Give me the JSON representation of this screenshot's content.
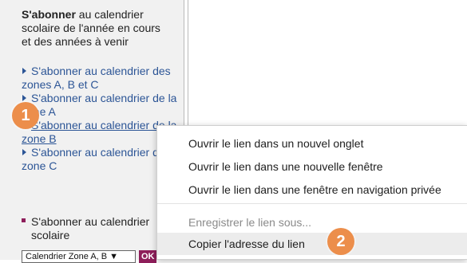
{
  "sidebar": {
    "intro_bold": "S'abonner",
    "intro_rest": " au calendrier scolaire de l'année en cours et des années à venir",
    "links": [
      {
        "label": "S'abonner au calendrier des zones A, B et C"
      },
      {
        "label": "S'abonner au calendrier de la zone A"
      },
      {
        "label": "S'abonner au calendrier de la zone B"
      },
      {
        "label": "S'abonner au calendrier de la zone C"
      }
    ],
    "subscribe_label": "S'abonner au calendrier scolaire",
    "select_value": "Calendrier Zone A, B ▼",
    "ok_label": "OK"
  },
  "context_menu": {
    "items": [
      {
        "label": "Ouvrir le lien dans un nouvel onglet",
        "enabled": true
      },
      {
        "label": "Ouvrir le lien dans une nouvelle fenêtre",
        "enabled": true
      },
      {
        "label": "Ouvrir le lien dans une fenêtre en navigation privée",
        "enabled": true
      },
      {
        "label": "Enregistrer le lien sous...",
        "enabled": false
      },
      {
        "label": "Copier l'adresse du lien",
        "enabled": true,
        "highlighted": true
      }
    ]
  },
  "annotations": {
    "step1": "1",
    "step2": "2"
  },
  "colors": {
    "link": "#2c5596",
    "accent": "#8e1e5a",
    "badge": "#ec8e4b"
  }
}
